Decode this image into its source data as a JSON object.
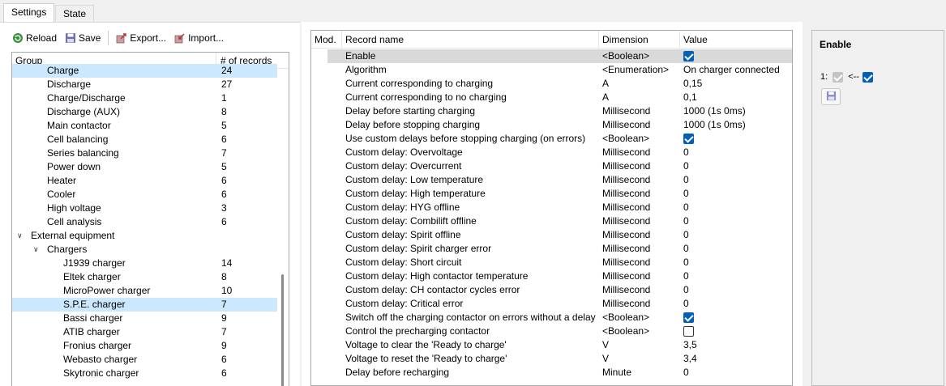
{
  "tabs": [
    {
      "label": "Settings",
      "active": true
    },
    {
      "label": "State",
      "active": false
    }
  ],
  "toolbar": {
    "reload_label": "Reload",
    "save_label": "Save",
    "export_label": "Export...",
    "import_label": "Import..."
  },
  "tree": {
    "columns": [
      "Group",
      "# of records"
    ],
    "rows": [
      {
        "label": "Charge",
        "count": "24",
        "indent": 2,
        "selected": true
      },
      {
        "label": "Discharge",
        "count": "27",
        "indent": 2
      },
      {
        "label": "Charge/Discharge",
        "count": "1",
        "indent": 2
      },
      {
        "label": "Discharge (AUX)",
        "count": "8",
        "indent": 2
      },
      {
        "label": "Main contactor",
        "count": "5",
        "indent": 2
      },
      {
        "label": "Cell balancing",
        "count": "6",
        "indent": 2
      },
      {
        "label": "Series balancing",
        "count": "7",
        "indent": 2
      },
      {
        "label": "Power down",
        "count": "5",
        "indent": 2
      },
      {
        "label": "Heater",
        "count": "6",
        "indent": 2
      },
      {
        "label": "Cooler",
        "count": "6",
        "indent": 2
      },
      {
        "label": "High voltage",
        "count": "3",
        "indent": 2
      },
      {
        "label": "Cell analysis",
        "count": "6",
        "indent": 2
      },
      {
        "label": "External equipment",
        "count": "",
        "indent": 0,
        "expanded": true
      },
      {
        "label": "Chargers",
        "count": "",
        "indent": 1,
        "expanded": true
      },
      {
        "label": "J1939 charger",
        "count": "14",
        "indent": 3
      },
      {
        "label": "Eltek charger",
        "count": "8",
        "indent": 3
      },
      {
        "label": "MicroPower charger",
        "count": "10",
        "indent": 3
      },
      {
        "label": "S.P.E. charger",
        "count": "7",
        "indent": 3,
        "highlighted": true
      },
      {
        "label": "Bassi charger",
        "count": "9",
        "indent": 3
      },
      {
        "label": "ATIB charger",
        "count": "7",
        "indent": 3
      },
      {
        "label": "Fronius charger",
        "count": "9",
        "indent": 3
      },
      {
        "label": "Webasto charger",
        "count": "6",
        "indent": 3
      },
      {
        "label": "Skytronic charger",
        "count": "6",
        "indent": 3
      }
    ]
  },
  "grid": {
    "columns": [
      "Mod.",
      "Record name",
      "Dimension",
      "Value"
    ],
    "rows": [
      {
        "name": "Enable",
        "dimension": "<Boolean>",
        "value": "",
        "check": "on",
        "selected": true
      },
      {
        "name": "Algorithm",
        "dimension": "<Enumeration>",
        "value": "On charger connected"
      },
      {
        "name": "Current corresponding to charging",
        "dimension": "A",
        "value": "0,15"
      },
      {
        "name": "Current corresponding to no charging",
        "dimension": "A",
        "value": "0,1"
      },
      {
        "name": "Delay before starting charging",
        "dimension": "Millisecond",
        "value": "1000 (1s 0ms)"
      },
      {
        "name": "Delay before stopping charging",
        "dimension": "Millisecond",
        "value": "1000 (1s 0ms)"
      },
      {
        "name": "Use custom delays before stopping charging (on errors)",
        "dimension": "<Boolean>",
        "value": "",
        "check": "on"
      },
      {
        "name": "Custom delay: Overvoltage",
        "dimension": "Millisecond",
        "value": "0"
      },
      {
        "name": "Custom delay: Overcurrent",
        "dimension": "Millisecond",
        "value": "0"
      },
      {
        "name": "Custom delay: Low temperature",
        "dimension": "Millisecond",
        "value": "0"
      },
      {
        "name": "Custom delay: High temperature",
        "dimension": "Millisecond",
        "value": "0"
      },
      {
        "name": "Custom delay: HYG offline",
        "dimension": "Millisecond",
        "value": "0"
      },
      {
        "name": "Custom delay: Combilift offline",
        "dimension": "Millisecond",
        "value": "0"
      },
      {
        "name": "Custom delay: Spirit offline",
        "dimension": "Millisecond",
        "value": "0"
      },
      {
        "name": "Custom delay: Spirit charger error",
        "dimension": "Millisecond",
        "value": "0"
      },
      {
        "name": "Custom delay: Short circuit",
        "dimension": "Millisecond",
        "value": "0"
      },
      {
        "name": "Custom delay: High contactor temperature",
        "dimension": "Millisecond",
        "value": "0"
      },
      {
        "name": "Custom delay: CH contactor cycles error",
        "dimension": "Millisecond",
        "value": "0"
      },
      {
        "name": "Custom delay: Critical error",
        "dimension": "Millisecond",
        "value": "0"
      },
      {
        "name": "Switch off the charging contactor on errors without a delay",
        "dimension": "<Boolean>",
        "value": "",
        "check": "on"
      },
      {
        "name": "Control the precharging contactor",
        "dimension": "<Boolean>",
        "value": "",
        "check": "off"
      },
      {
        "name": "Voltage to clear the 'Ready to charge'",
        "dimension": "V",
        "value": "3,5"
      },
      {
        "name": "Voltage to reset the 'Ready to charge'",
        "dimension": "V",
        "value": "3,4"
      },
      {
        "name": "Delay before recharging",
        "dimension": "Minute",
        "value": "0"
      }
    ]
  },
  "right_panel": {
    "title": "Enable",
    "row_index": "1:",
    "arrow_label": "<--"
  },
  "colors": {
    "tree_selected": "#cce8ff",
    "grid_selected": "#d9d9d9",
    "checkbox_on": "#005fb8"
  }
}
